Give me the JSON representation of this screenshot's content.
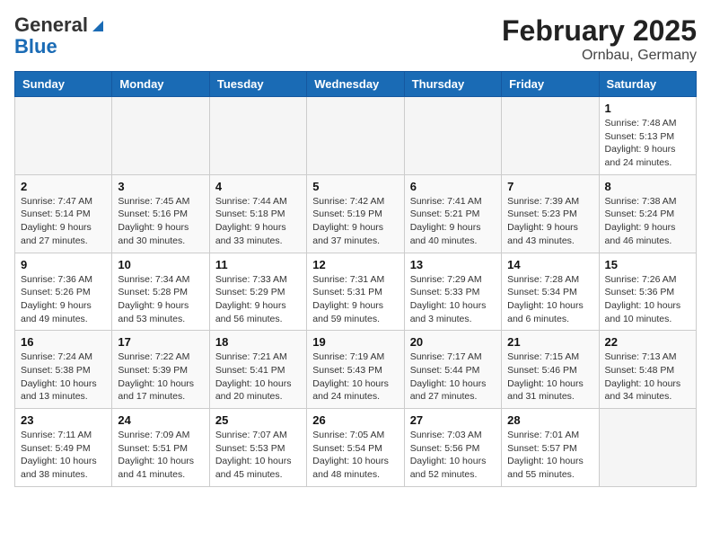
{
  "header": {
    "logo_general": "General",
    "logo_blue": "Blue",
    "month": "February 2025",
    "location": "Ornbau, Germany"
  },
  "weekdays": [
    "Sunday",
    "Monday",
    "Tuesday",
    "Wednesday",
    "Thursday",
    "Friday",
    "Saturday"
  ],
  "weeks": [
    [
      {
        "day": "",
        "info": ""
      },
      {
        "day": "",
        "info": ""
      },
      {
        "day": "",
        "info": ""
      },
      {
        "day": "",
        "info": ""
      },
      {
        "day": "",
        "info": ""
      },
      {
        "day": "",
        "info": ""
      },
      {
        "day": "1",
        "info": "Sunrise: 7:48 AM\nSunset: 5:13 PM\nDaylight: 9 hours and 24 minutes."
      }
    ],
    [
      {
        "day": "2",
        "info": "Sunrise: 7:47 AM\nSunset: 5:14 PM\nDaylight: 9 hours and 27 minutes."
      },
      {
        "day": "3",
        "info": "Sunrise: 7:45 AM\nSunset: 5:16 PM\nDaylight: 9 hours and 30 minutes."
      },
      {
        "day": "4",
        "info": "Sunrise: 7:44 AM\nSunset: 5:18 PM\nDaylight: 9 hours and 33 minutes."
      },
      {
        "day": "5",
        "info": "Sunrise: 7:42 AM\nSunset: 5:19 PM\nDaylight: 9 hours and 37 minutes."
      },
      {
        "day": "6",
        "info": "Sunrise: 7:41 AM\nSunset: 5:21 PM\nDaylight: 9 hours and 40 minutes."
      },
      {
        "day": "7",
        "info": "Sunrise: 7:39 AM\nSunset: 5:23 PM\nDaylight: 9 hours and 43 minutes."
      },
      {
        "day": "8",
        "info": "Sunrise: 7:38 AM\nSunset: 5:24 PM\nDaylight: 9 hours and 46 minutes."
      }
    ],
    [
      {
        "day": "9",
        "info": "Sunrise: 7:36 AM\nSunset: 5:26 PM\nDaylight: 9 hours and 49 minutes."
      },
      {
        "day": "10",
        "info": "Sunrise: 7:34 AM\nSunset: 5:28 PM\nDaylight: 9 hours and 53 minutes."
      },
      {
        "day": "11",
        "info": "Sunrise: 7:33 AM\nSunset: 5:29 PM\nDaylight: 9 hours and 56 minutes."
      },
      {
        "day": "12",
        "info": "Sunrise: 7:31 AM\nSunset: 5:31 PM\nDaylight: 9 hours and 59 minutes."
      },
      {
        "day": "13",
        "info": "Sunrise: 7:29 AM\nSunset: 5:33 PM\nDaylight: 10 hours and 3 minutes."
      },
      {
        "day": "14",
        "info": "Sunrise: 7:28 AM\nSunset: 5:34 PM\nDaylight: 10 hours and 6 minutes."
      },
      {
        "day": "15",
        "info": "Sunrise: 7:26 AM\nSunset: 5:36 PM\nDaylight: 10 hours and 10 minutes."
      }
    ],
    [
      {
        "day": "16",
        "info": "Sunrise: 7:24 AM\nSunset: 5:38 PM\nDaylight: 10 hours and 13 minutes."
      },
      {
        "day": "17",
        "info": "Sunrise: 7:22 AM\nSunset: 5:39 PM\nDaylight: 10 hours and 17 minutes."
      },
      {
        "day": "18",
        "info": "Sunrise: 7:21 AM\nSunset: 5:41 PM\nDaylight: 10 hours and 20 minutes."
      },
      {
        "day": "19",
        "info": "Sunrise: 7:19 AM\nSunset: 5:43 PM\nDaylight: 10 hours and 24 minutes."
      },
      {
        "day": "20",
        "info": "Sunrise: 7:17 AM\nSunset: 5:44 PM\nDaylight: 10 hours and 27 minutes."
      },
      {
        "day": "21",
        "info": "Sunrise: 7:15 AM\nSunset: 5:46 PM\nDaylight: 10 hours and 31 minutes."
      },
      {
        "day": "22",
        "info": "Sunrise: 7:13 AM\nSunset: 5:48 PM\nDaylight: 10 hours and 34 minutes."
      }
    ],
    [
      {
        "day": "23",
        "info": "Sunrise: 7:11 AM\nSunset: 5:49 PM\nDaylight: 10 hours and 38 minutes."
      },
      {
        "day": "24",
        "info": "Sunrise: 7:09 AM\nSunset: 5:51 PM\nDaylight: 10 hours and 41 minutes."
      },
      {
        "day": "25",
        "info": "Sunrise: 7:07 AM\nSunset: 5:53 PM\nDaylight: 10 hours and 45 minutes."
      },
      {
        "day": "26",
        "info": "Sunrise: 7:05 AM\nSunset: 5:54 PM\nDaylight: 10 hours and 48 minutes."
      },
      {
        "day": "27",
        "info": "Sunrise: 7:03 AM\nSunset: 5:56 PM\nDaylight: 10 hours and 52 minutes."
      },
      {
        "day": "28",
        "info": "Sunrise: 7:01 AM\nSunset: 5:57 PM\nDaylight: 10 hours and 55 minutes."
      },
      {
        "day": "",
        "info": ""
      }
    ]
  ]
}
